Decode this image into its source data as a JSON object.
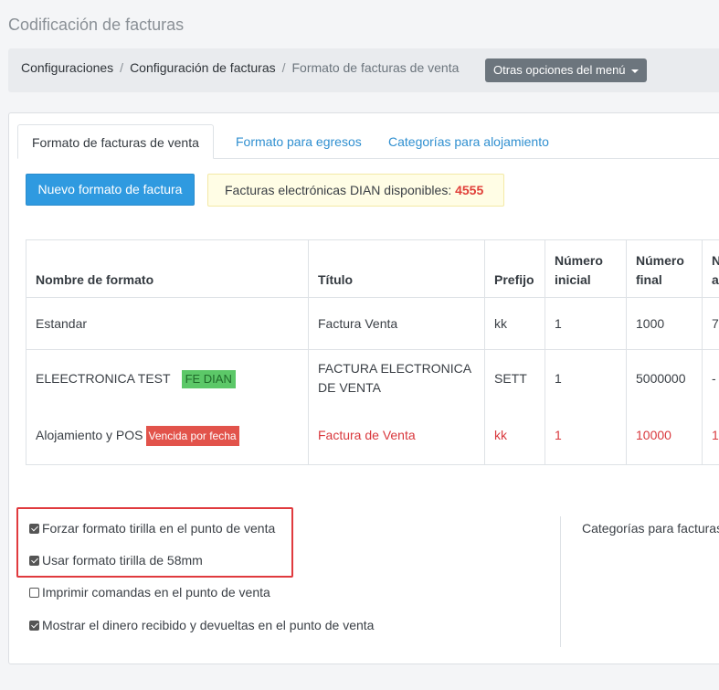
{
  "page": {
    "title": "Codificación de facturas"
  },
  "breadcrumb": {
    "items": [
      "Configuraciones",
      "Configuración de facturas",
      "Formato de facturas de venta"
    ],
    "separator": "/",
    "menu_button": "Otras opciones del menú"
  },
  "tabs": [
    {
      "label": "Formato de facturas de venta",
      "active": true
    },
    {
      "label": "Formato para egresos",
      "active": false
    },
    {
      "label": "Categorías para alojamiento",
      "active": false
    }
  ],
  "actions": {
    "new_format_button": "Nuevo formato de factura",
    "dian_label": "Facturas electrónicas DIAN disponibles: ",
    "dian_count": "4555"
  },
  "table": {
    "headers": [
      "Nombre de formato",
      "Título",
      "Prefijo",
      "Número inicial",
      "Número final",
      "N a"
    ],
    "header_lines": {
      "inicial_1": "Número",
      "inicial_2": "inicial",
      "final_1": "Número",
      "final_2": "final",
      "next_1": "N",
      "next_2": "a"
    },
    "rows": [
      {
        "name": "Estandar",
        "badge": "",
        "title": "Factura Venta",
        "prefix": "kk",
        "start": "1",
        "end": "1000",
        "next": "7"
      },
      {
        "name": "ELEECTRONICA TEST",
        "badge": "FE DIAN",
        "title": "FACTURA ELECTRONICA DE VENTA",
        "prefix": "SETT",
        "start": "1",
        "end": "5000000",
        "next": "-"
      },
      {
        "name": "Alojamiento y POS",
        "badge": "Vencida por fecha",
        "title": "Factura de Venta",
        "prefix": "kk",
        "start": "1",
        "end": "10000",
        "next": "1"
      }
    ]
  },
  "options": {
    "force_tirilla": {
      "label": "Forzar formato tirilla en el punto de venta",
      "checked": true
    },
    "tirilla_58mm": {
      "label": "Usar formato tirilla de 58mm",
      "checked": true
    },
    "print_orders": {
      "label": "Imprimir comandas en el punto de venta",
      "checked": false
    },
    "show_change": {
      "label": "Mostrar el dinero recibido y devueltas en el punto de venta",
      "checked": true
    }
  },
  "side": {
    "categories_label": "Categorías para facturas"
  },
  "colors": {
    "accent": "#2f9ae0",
    "danger": "#e2534b",
    "success": "#5cc868",
    "highlight": "#e03a3e"
  }
}
